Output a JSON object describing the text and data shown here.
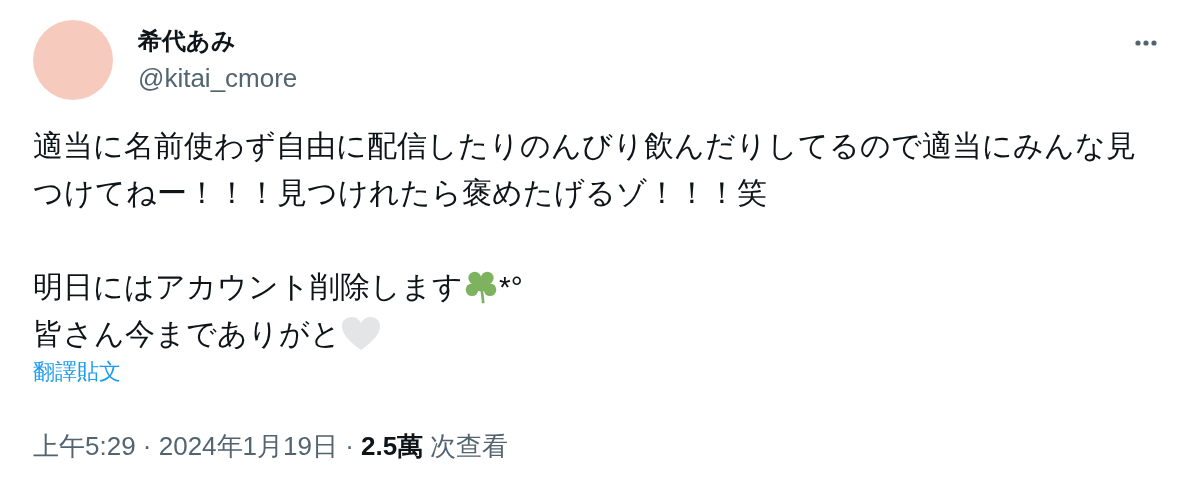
{
  "author": {
    "name": "希代あみ",
    "handle": "@kitai_cmore"
  },
  "body": [
    {
      "lines": [
        [
          {
            "kind": "text",
            "text": "適当に名前使わず自由に配信したりのんびり飲んだりしてるので適当にみんな見つけてねー！！！見つけれたら褒めたげるゾ！！！笑"
          }
        ]
      ]
    },
    {
      "lines": [
        [
          {
            "kind": "text",
            "text": "明日にはアカウント削除します"
          },
          {
            "kind": "clover"
          },
          {
            "kind": "text",
            "text": "*°"
          }
        ],
        [
          {
            "kind": "text",
            "text": "皆さん今までありがと"
          },
          {
            "kind": "heart"
          }
        ]
      ]
    }
  ],
  "translate_link": "翻譯貼文",
  "meta": "上午5:29 · 2024年1月19日 · **2.5萬** 次查看"
}
